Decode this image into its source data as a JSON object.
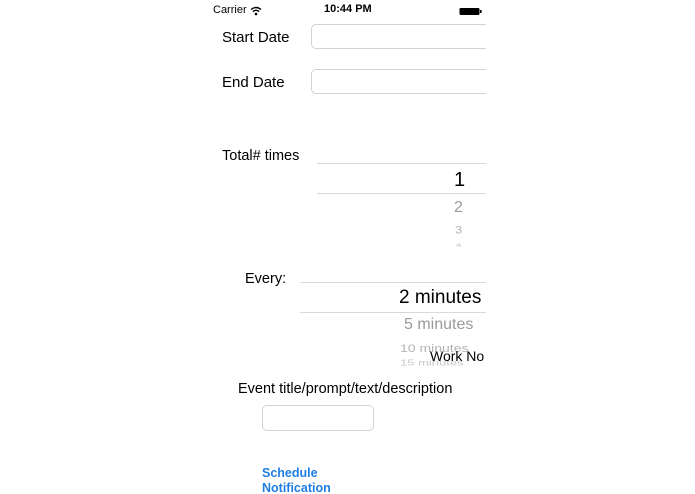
{
  "status_bar": {
    "carrier": "Carrier",
    "time": "10:44 PM",
    "wifi_icon": "wifi-icon",
    "battery_icon": "battery-icon"
  },
  "form": {
    "start_date_label": "Start Date",
    "start_date_value": "",
    "end_date_label": "End Date",
    "end_date_value": "",
    "total_times_label": "Total# times",
    "total_times_picker": {
      "selected": "1",
      "options": [
        "2",
        "3",
        "4"
      ]
    },
    "every_label": "Every:",
    "every_picker": {
      "selected": "2 minutes",
      "options": [
        "5 minutes",
        "10 minutes",
        "15 minutes"
      ]
    },
    "overlay_text": "Work No",
    "event_title_label": "Event title/prompt/text/description",
    "event_title_value": "",
    "schedule_button_line1": "Schedule",
    "schedule_button_line2": "Notification"
  }
}
